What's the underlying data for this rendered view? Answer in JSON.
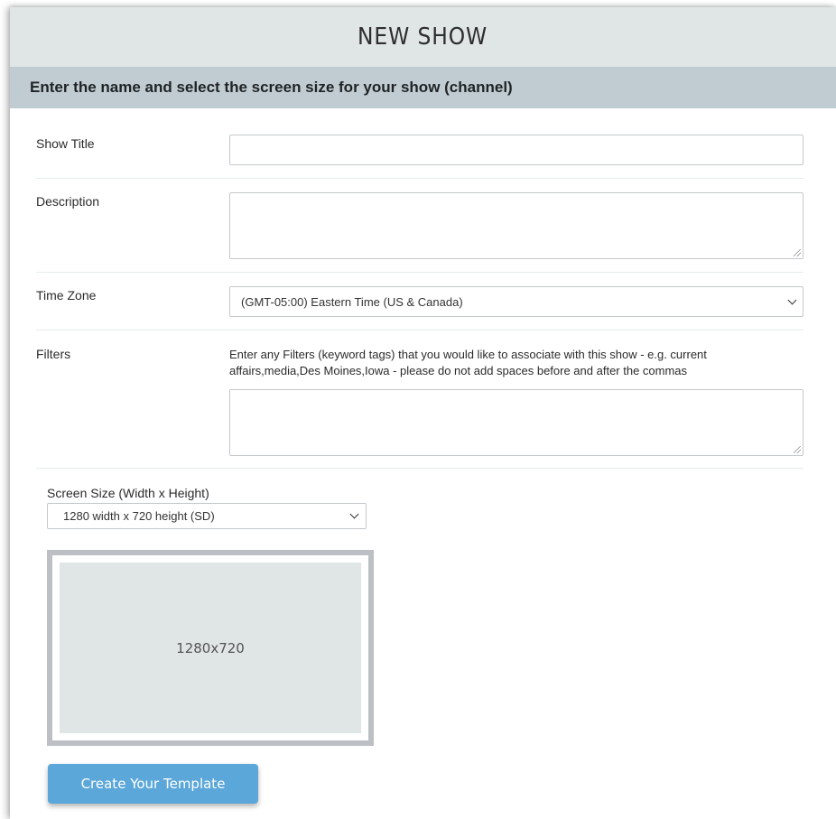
{
  "header": {
    "title": "NEW SHOW",
    "subtitle": "Enter the name and select the screen size for your show (channel)"
  },
  "form": {
    "show_title": {
      "label": "Show Title",
      "value": ""
    },
    "description": {
      "label": "Description",
      "value": ""
    },
    "time_zone": {
      "label": "Time Zone",
      "value": "(GMT-05:00) Eastern Time (US & Canada)"
    },
    "filters": {
      "label": "Filters",
      "help": "Enter any Filters (keyword tags) that you would like to associate with this show - e.g. current affairs,media,Des Moines,Iowa - please do not add spaces before and after the commas",
      "value": ""
    },
    "screen_size": {
      "label": "Screen Size (Width x Height)",
      "value": "1280 width x 720 height (SD)",
      "preview_label": "1280x720"
    }
  },
  "actions": {
    "create_label": "Create Your Template"
  },
  "colors": {
    "title_bg": "#e0e5e5",
    "subtitle_bg": "#c1ccd2",
    "button_bg": "#5ba7d9"
  }
}
